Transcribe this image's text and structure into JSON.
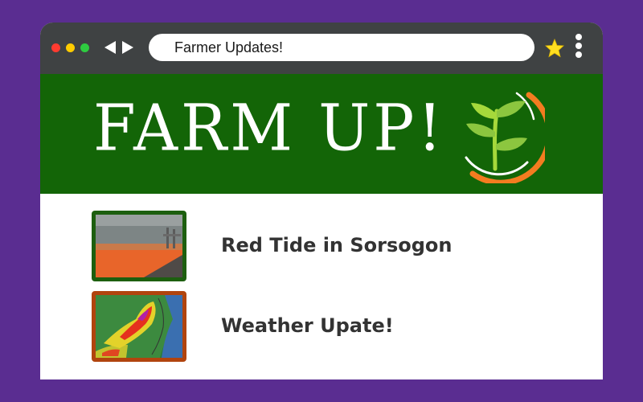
{
  "browser": {
    "address_text": "Farmer Updates!",
    "icons": [
      "close-dot",
      "minimize-dot",
      "maximize-dot",
      "back-arrow-icon",
      "forward-arrow-icon",
      "star-icon",
      "kebab-menu-icon"
    ]
  },
  "banner": {
    "title": "FARM UP!",
    "logo_icon": "sprout-icon",
    "background": "#136507"
  },
  "news": [
    {
      "title": "Red Tide in Sorsogon",
      "border_color": "#1d5f0f"
    },
    {
      "title": "Weather Upate!",
      "border_color": "#b1440e"
    }
  ],
  "colors": {
    "page_background": "#5a2d91",
    "chrome": "#3f4243",
    "accent_orange": "#f47c20"
  }
}
